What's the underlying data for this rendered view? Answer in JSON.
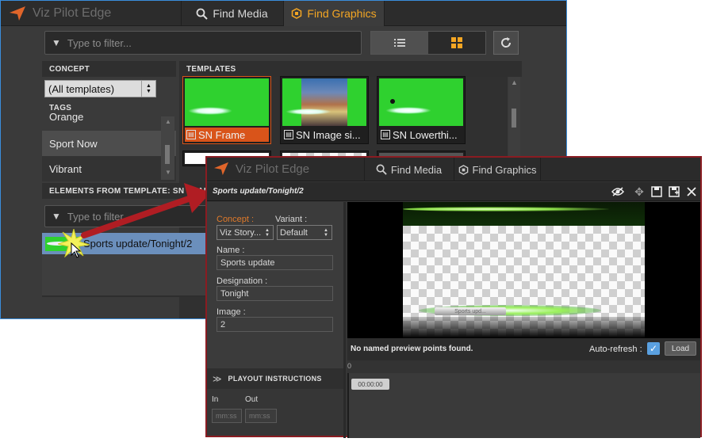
{
  "main_window": {
    "app_title": "Viz Pilot Edge",
    "tabs": [
      {
        "label": "Find Media"
      },
      {
        "label": "Find Graphics"
      }
    ],
    "filter_placeholder": "Type to filter...",
    "concept_header": "CONCEPT",
    "concept_select": "(All templates)",
    "tags_header": "TAGS",
    "tags": [
      "Orange",
      "Sport Now",
      "Vibrant"
    ],
    "templates_header": "TEMPLATES",
    "templates": [
      {
        "name": "SN Frame"
      },
      {
        "name": "SN Image si..."
      },
      {
        "name": "SN Lowerthi..."
      }
    ],
    "elements_header": "ELEMENTS FROM TEMPLATE: SN FRAME",
    "elements_filter_placeholder": "Type to filter",
    "element_item": "Sports update/Tonight/2"
  },
  "editor_window": {
    "app_title": "Viz Pilot Edge",
    "tabs": [
      {
        "label": "Find Media"
      },
      {
        "label": "Find Graphics"
      }
    ],
    "element_title": "Sports update/Tonight/2",
    "concept_label": "Concept :",
    "concept_value": "Viz Story...",
    "variant_label": "Variant :",
    "variant_value": "Default",
    "name_label": "Name :",
    "name_value": "Sports update",
    "designation_label": "Designation :",
    "designation_value": "Tonight",
    "image_label": "Image :",
    "image_value": "2",
    "playout_header": "PLAYOUT INSTRUCTIONS",
    "in_label": "In",
    "out_label": "Out",
    "in_placeholder": "mm:ss",
    "out_placeholder": "mm:ss",
    "preview_text": "Sports upd...",
    "preview_message": "No named preview points found.",
    "auto_refresh_label": "Auto-refresh :",
    "load_button": "Load",
    "timeline_zero": "0",
    "timecode": "00:00:00"
  },
  "colors": {
    "accent": "#f4a623",
    "selected_template": "#d9541a",
    "editor_border": "#8a1c22",
    "window_border": "#3a8ddc",
    "checkbox": "#5aa0e0"
  }
}
